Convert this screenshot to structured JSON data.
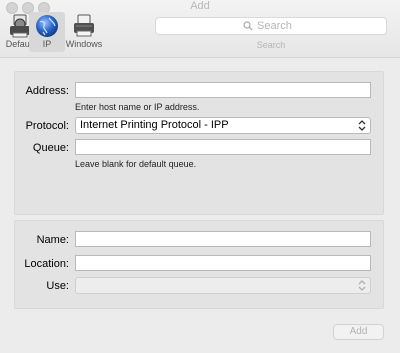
{
  "window": {
    "title": "Add"
  },
  "toolbar": {
    "items": [
      {
        "label": "Default",
        "icon": "default-printer-icon"
      },
      {
        "label": "IP",
        "icon": "globe-icon",
        "selected": true
      },
      {
        "label": "Windows",
        "icon": "windows-printer-icon"
      }
    ],
    "search": {
      "placeholder": "Search",
      "caption": "Search"
    }
  },
  "form": {
    "address": {
      "label": "Address:",
      "value": "",
      "hint": "Enter host name or IP address."
    },
    "protocol": {
      "label": "Protocol:",
      "value": "Internet Printing Protocol - IPP"
    },
    "queue": {
      "label": "Queue:",
      "value": "",
      "hint": "Leave blank for default queue."
    },
    "name": {
      "label": "Name:",
      "value": ""
    },
    "location": {
      "label": "Location:",
      "value": ""
    },
    "use": {
      "label": "Use:",
      "value": ""
    }
  },
  "actions": {
    "add_label": "Add"
  },
  "colors": {
    "accent": "#2a64c5",
    "panel": "#e3e3e3",
    "window": "#ececec"
  }
}
